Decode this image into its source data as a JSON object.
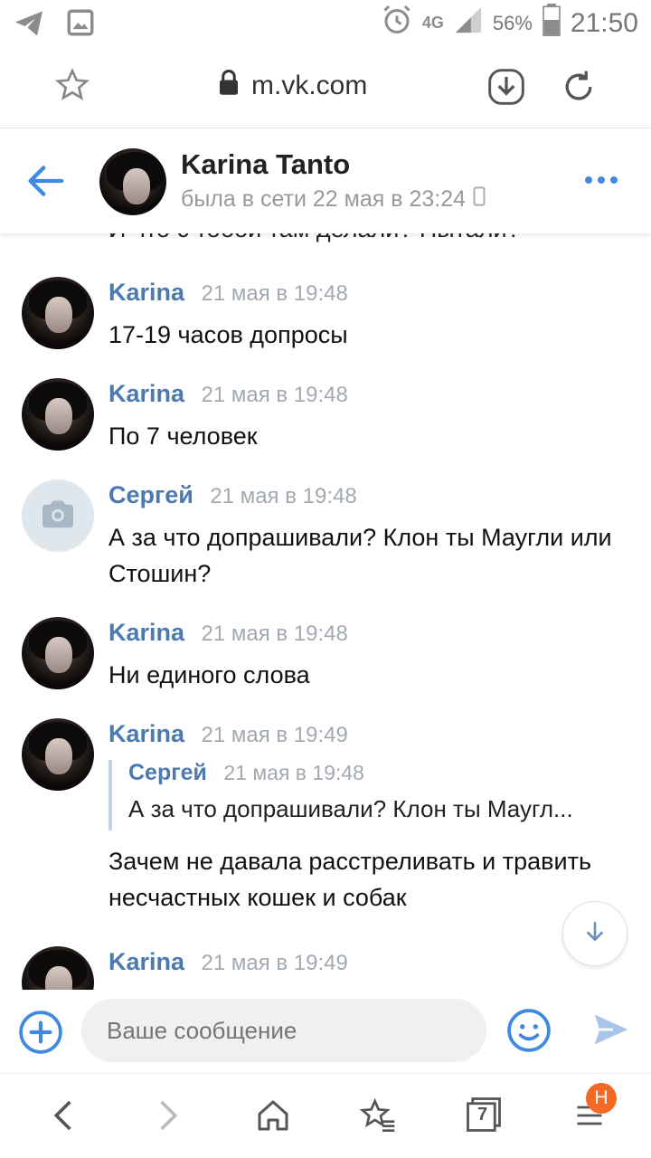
{
  "status_bar": {
    "network": "4G",
    "battery": "56%",
    "time": "21:50",
    "icons": [
      "telegram-icon",
      "image-icon",
      "alarm-icon",
      "signal-icon",
      "battery-icon"
    ]
  },
  "browser": {
    "url": "m.vk.com",
    "icons": [
      "star-icon",
      "lock-icon",
      "download-icon",
      "reload-icon"
    ]
  },
  "chat_header": {
    "name": "Karina Tanto",
    "status": "была в сети 22 мая в 23:24"
  },
  "partial_message": {
    "text": "И что с тобой там делали? Пытали?"
  },
  "messages": [
    {
      "author": "Karina",
      "time": "21 мая в 19:48",
      "text": "17-19 часов допросы",
      "avatar": "photo"
    },
    {
      "author": "Karina",
      "time": "21 мая в 19:48",
      "text": "По 7 человек",
      "avatar": "photo"
    },
    {
      "author": "Сергей",
      "time": "21 мая в 19:48",
      "text": "А за что допрашивали? Клон ты Маугли или Стошин?",
      "avatar": "camera-placeholder"
    },
    {
      "author": "Karina",
      "time": "21 мая в 19:48",
      "text": "Ни единого слова",
      "avatar": "photo"
    },
    {
      "author": "Karina",
      "time": "21 мая в 19:49",
      "avatar": "photo",
      "reply": {
        "author": "Сергей",
        "time": "21 мая в 19:48",
        "text": "А за что допрашивали? Клон ты Маугл..."
      },
      "text": "Зачем не давала расстреливать и травить несчастных кошек и собак"
    },
    {
      "author": "Karina",
      "time": "21 мая в 19:49",
      "text": "",
      "avatar": "photo"
    }
  ],
  "composer": {
    "placeholder": "Ваше сообщение"
  },
  "bottom_nav": {
    "tabs_count": "7",
    "menu_badge": "Н"
  },
  "colors": {
    "accent": "#4a7ab0",
    "icon_blue": "#3f8ae0",
    "badge": "#f26a23"
  }
}
